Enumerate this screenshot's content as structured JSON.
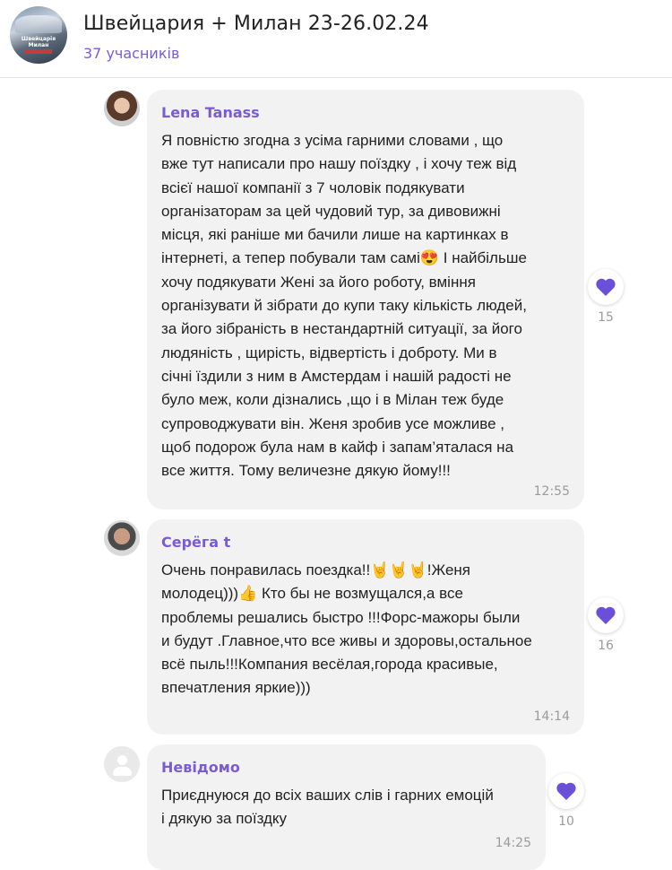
{
  "header": {
    "title": "Швейцария + Милан 23-26.02.24",
    "members": "37 учасників",
    "avatar_caption": "Швейцарія Милан"
  },
  "messages": [
    {
      "author": "Lena Tanass",
      "lines": [
        "Я повністю згодна з усіма гарними словами , що",
        "вже тут написали про нашу поїздку , і хочу теж від",
        "всієї нашої компанії з 7 чоловік подякувати",
        "організаторам за цей чудовий тур, за дивовижні",
        "місця, які раніше ми бачили лише на картинках в",
        "інтернеті, а тепер побували там самі😍  І найбільше",
        "хочу подякувати Жені за його роботу, вміння",
        "організувати й зібрати до купи таку кількість людей,",
        "за його зібраність в нестандартній ситуації, за його",
        "людяність , щирість, відвертість і доброту. Ми в",
        "січні їздили з ним в Амстердам і нашій радості не",
        "було меж, коли дізнались ,що і в Мілан теж буде",
        "супроводжувати він.  Женя зробив усе можливе ,",
        "щоб  подорож була нам в кайф і запам’яталася на",
        "все життя. Тому величезне дякую йому!!!"
      ],
      "time": "12:55",
      "likes": "15"
    },
    {
      "author": "Серёга t",
      "lines": [
        "Очень понравилась поездка!!🤘🤘🤘!Женя",
        "молодец)))👍 Кто бы не возмущался,а все",
        "проблемы решались быстро !!!Форс-мажоры были",
        "и будут .Главное,что все живы и здоровы,остальное",
        "всё пыль!!!Компания весёлая,города красивые,",
        "впечатления яркие)))"
      ],
      "time": "14:14",
      "likes": "16"
    },
    {
      "author": "Невідомо",
      "lines": [
        "Приєднуюся до всіх ваших слів і гарних емоцій",
        "і дякую за поїздку"
      ],
      "time": "14:25",
      "likes": "10"
    }
  ],
  "colors": {
    "accent": "#7a5bd6",
    "heart": "#6a4fd8",
    "bubble": "#f2f2f3"
  },
  "icons": [
    "heart-icon",
    "user-placeholder-icon"
  ]
}
